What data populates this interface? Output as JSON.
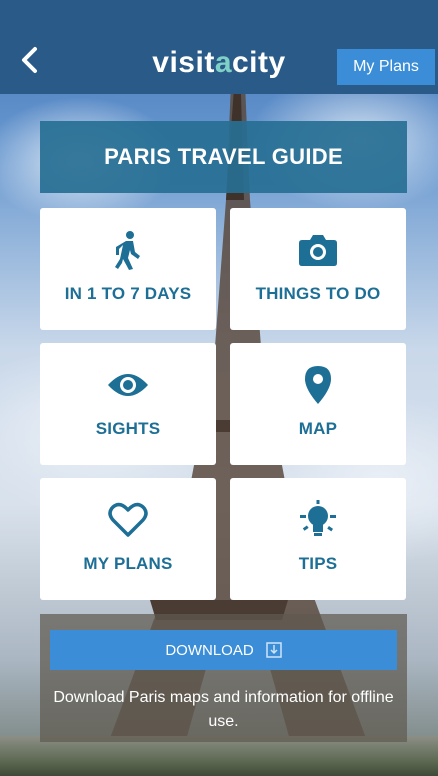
{
  "header": {
    "logo_part1": "visit",
    "logo_accent": "a",
    "logo_part2": "city",
    "my_plans_label": "My Plans",
    "back_icon": "chevron-left-icon"
  },
  "banner": {
    "title": "PARIS TRAVEL GUIDE"
  },
  "tiles": [
    {
      "label": "IN 1 TO 7 DAYS",
      "icon": "walking-person-icon"
    },
    {
      "label": "THINGS TO DO",
      "icon": "camera-icon"
    },
    {
      "label": "SIGHTS",
      "icon": "eye-icon"
    },
    {
      "label": "MAP",
      "icon": "map-pin-icon"
    },
    {
      "label": "MY PLANS",
      "icon": "heart-icon"
    },
    {
      "label": "TIPS",
      "icon": "lightbulb-icon"
    }
  ],
  "download": {
    "button_label": "DOWNLOAD",
    "icon": "download-icon",
    "description": "Download Paris maps and information for offline use."
  },
  "colors": {
    "header_bg": "#2a5a87",
    "accent_blue": "#3a8dd6",
    "tile_text": "#1e6f96",
    "logo_accent": "#7fd1c8"
  }
}
